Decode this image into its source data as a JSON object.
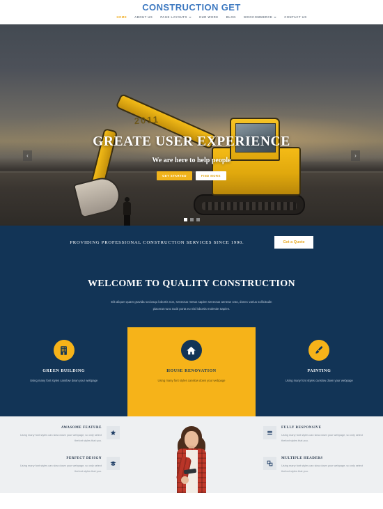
{
  "header": {
    "logo": "CONSTRUCTION GET",
    "nav": [
      {
        "label": "HOME",
        "active": true,
        "caret": false
      },
      {
        "label": "ABOUT US",
        "active": false,
        "caret": false
      },
      {
        "label": "PAGE LAYOUTS",
        "active": false,
        "caret": true
      },
      {
        "label": "OUR WORK",
        "active": false,
        "caret": false
      },
      {
        "label": "BLOG",
        "active": false,
        "caret": false
      },
      {
        "label": "WOOCOMMERCE",
        "active": false,
        "caret": true
      },
      {
        "label": "CONTACT US",
        "active": false,
        "caret": false
      }
    ]
  },
  "hero": {
    "title": "GREATE USER EXPERIENCE",
    "subtitle": "We are here to help people",
    "btn_primary": "Get Started",
    "btn_secondary": "Find More",
    "prev_arrow": "‹",
    "next_arrow": "›",
    "machine_label": "2011",
    "slides": 3,
    "active_slide": 1
  },
  "cta": {
    "text": "PROVIDING PROFESSIONAL CONSTRUCTION SERVICES SINCE 1990.",
    "button": "Get a Quote"
  },
  "welcome": {
    "heading": "WELCOME TO QUALITY CONSTRUCTION",
    "paragraph": "Elit aliquet quam gravida sociosqu lobortis non, senectus metus sapien senectus aenean cras, donec varius sollicitudin placerat nunc taciti porta eu nisi lobortis molestie Sapien."
  },
  "services": [
    {
      "title": "GREEN BUILDING",
      "desc": "Using many font styles canslow down your webpage",
      "icon": "building-icon",
      "featured": false
    },
    {
      "title": "HOUSE RENOVATION",
      "desc": "Using many font styles canslow down your webpage",
      "icon": "home-icon",
      "featured": true
    },
    {
      "title": "PAINTING",
      "desc": "Using many font styles canslow down your webpage",
      "icon": "paintbrush-icon",
      "featured": false
    }
  ],
  "features": {
    "left": [
      {
        "title": "AWASOME FEATURE",
        "desc": "Using many font styles can slow down your webpage, so only select thefont styles that you.",
        "icon": "star-icon"
      },
      {
        "title": "PERFECT DESIGN",
        "desc": "Using many font styles can slow down your webpage, so only select thefont styles that you.",
        "icon": "graduation-cap-icon"
      }
    ],
    "right": [
      {
        "title": "FULLY RESPONSIVE",
        "desc": "Using many font styles can slow down your webpage, so only select thefont styles that you.",
        "icon": "menu-lines-icon"
      },
      {
        "title": "MULTIPLE HEADERS",
        "desc": "Using many font styles can slow down your webpage, so only select thefont styles that you.",
        "icon": "layers-icon"
      }
    ]
  },
  "colors": {
    "navy": "#123456",
    "yellow": "#f6b319",
    "logo_blue": "#3c78c0",
    "light_gray": "#eef0f2"
  }
}
